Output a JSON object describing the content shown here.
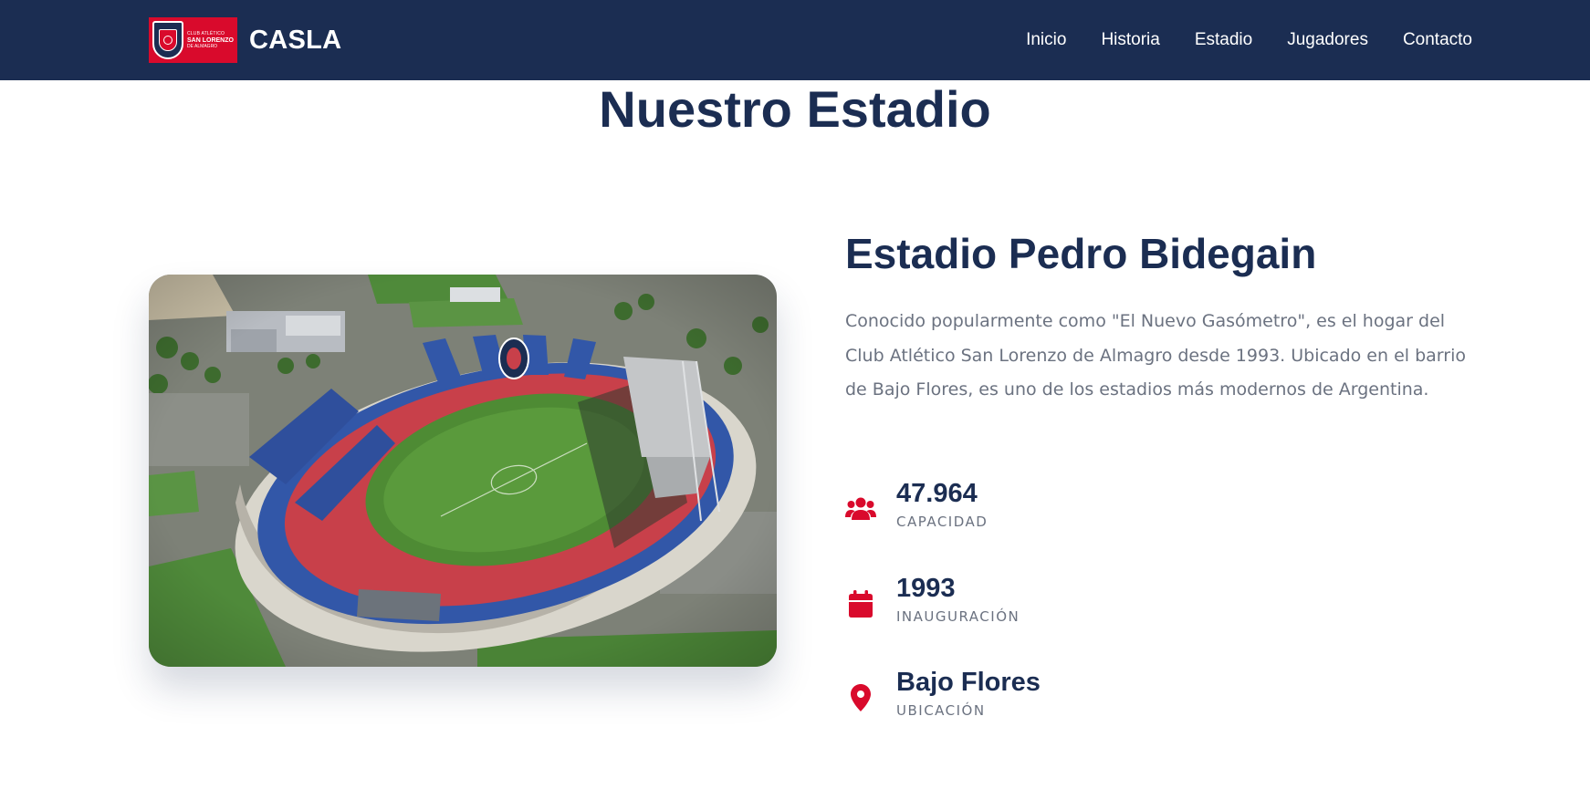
{
  "header": {
    "logo": {
      "line1": "CLUB ATLÉTICO",
      "line2": "SAN LORENZO",
      "line3": "DE ALMAGRO"
    },
    "brand": "CASLA",
    "nav": [
      {
        "label": "Inicio"
      },
      {
        "label": "Historia"
      },
      {
        "label": "Estadio"
      },
      {
        "label": "Jugadores"
      },
      {
        "label": "Contacto"
      }
    ]
  },
  "main": {
    "section_title": "Nuestro Estadio",
    "stadium_name": "Estadio Pedro Bidegain",
    "description": "Conocido popularmente como \"El Nuevo Gasómetro\", es el hogar del Club Atlético San Lorenzo de Almagro desde 1993. Ubicado en el barrio de Bajo Flores, es uno de los estadios más modernos de Argentina.",
    "stats": [
      {
        "icon": "users-icon",
        "value": "47.964",
        "label": "CAPACIDAD"
      },
      {
        "icon": "calendar-icon",
        "value": "1993",
        "label": "INAUGURACIÓN"
      },
      {
        "icon": "map-pin-icon",
        "value": "Bajo Flores",
        "label": "UBICACIÓN"
      }
    ]
  },
  "colors": {
    "navy": "#1b2d52",
    "red": "#d90a2c",
    "muted_text": "#6b7280",
    "white": "#ffffff"
  }
}
